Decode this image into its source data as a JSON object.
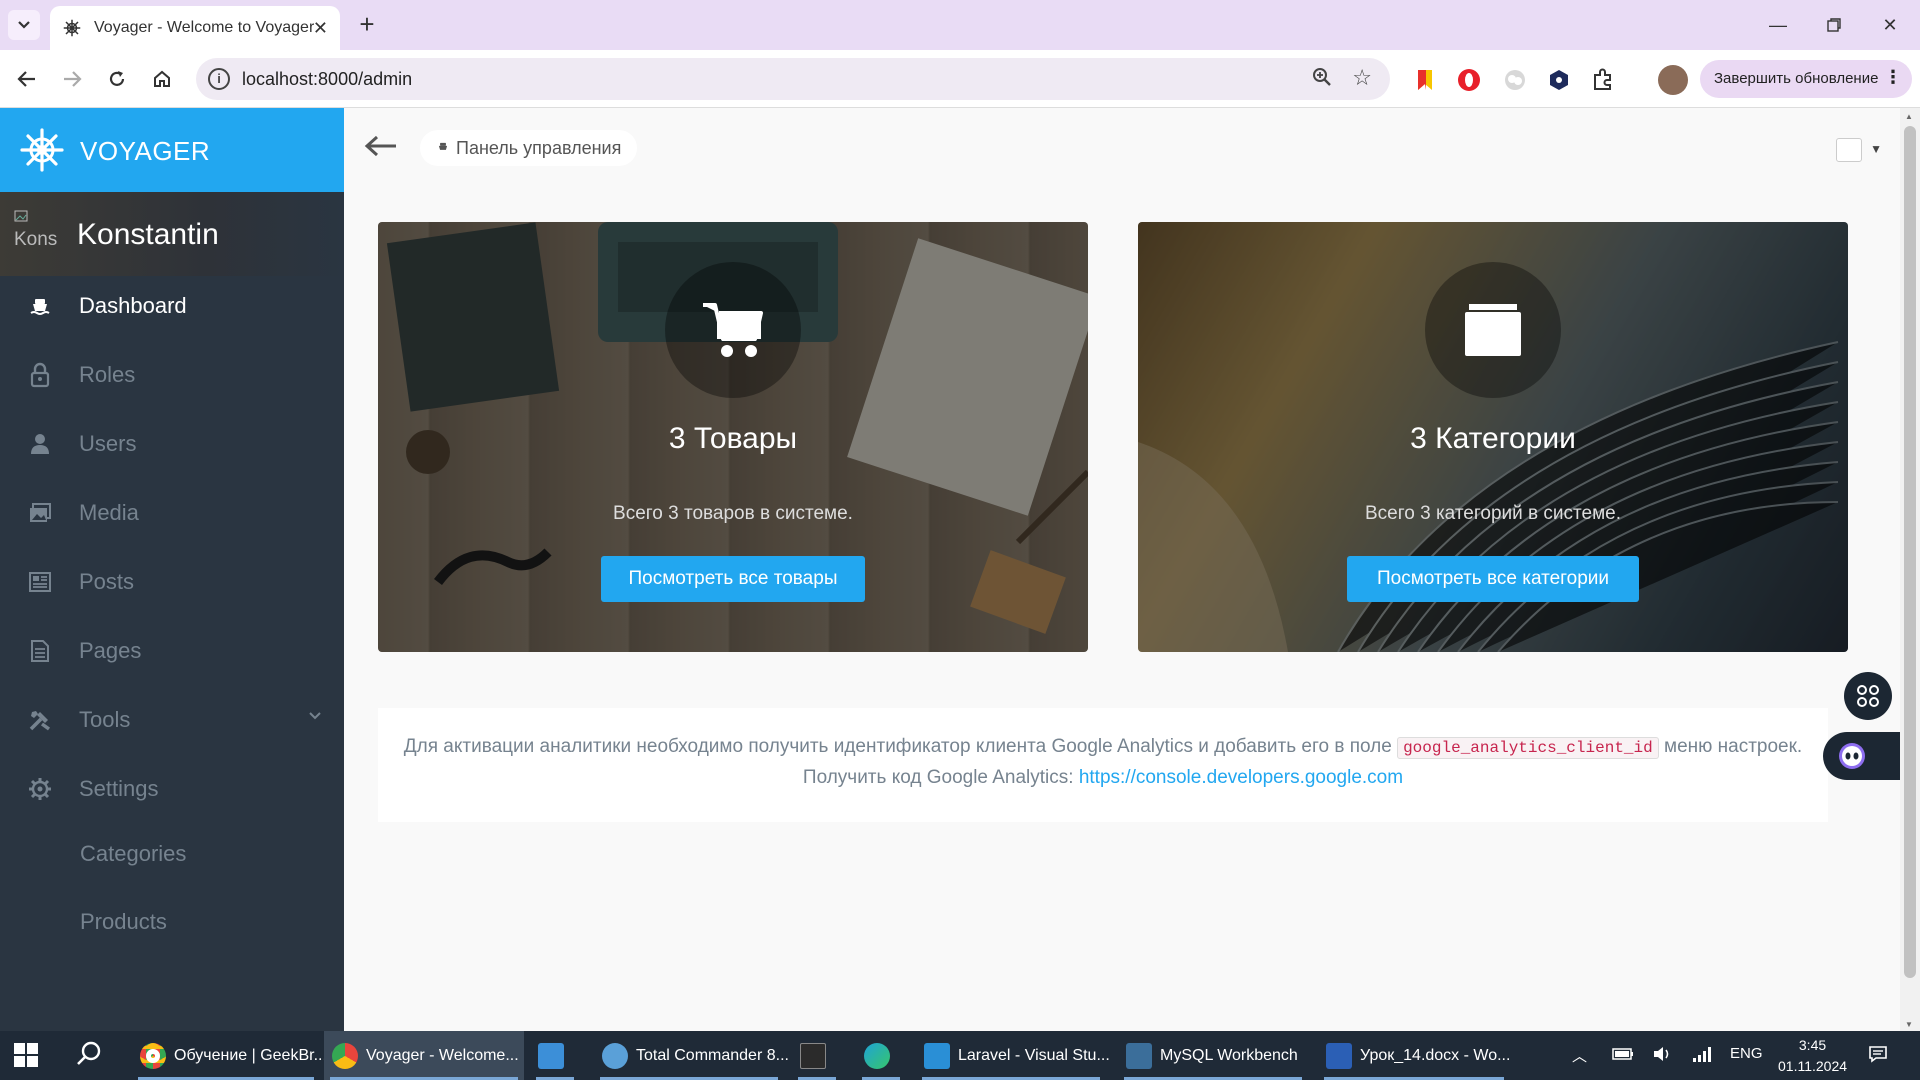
{
  "browser": {
    "tab_title": "Voyager - Welcome to Voyager",
    "url": "localhost:8000/admin",
    "update_button": "Завершить обновление"
  },
  "sidebar": {
    "brand": "VOYAGER",
    "user_name": "Konstantin",
    "avatar_alt": "Kons",
    "items": [
      {
        "label": "Dashboard",
        "icon": "boat-icon",
        "active": true
      },
      {
        "label": "Roles",
        "icon": "lock-icon"
      },
      {
        "label": "Users",
        "icon": "person-icon"
      },
      {
        "label": "Media",
        "icon": "images-icon"
      },
      {
        "label": "Posts",
        "icon": "news-icon"
      },
      {
        "label": "Pages",
        "icon": "file-text-icon"
      },
      {
        "label": "Tools",
        "icon": "tools-icon"
      },
      {
        "label": "Settings",
        "icon": "gear-icon"
      }
    ],
    "subitems": [
      {
        "label": "Categories"
      },
      {
        "label": "Products"
      }
    ]
  },
  "main": {
    "breadcrumb": "Панель управления",
    "cards": [
      {
        "title": "3 Товары",
        "description": "Всего 3 товаров в системе.",
        "button": "Посмотреть все товары",
        "icon": "cart-icon"
      },
      {
        "title": "3 Категории",
        "description": "Всего 3 категорий в системе.",
        "button": "Посмотреть все категории",
        "icon": "folder-icon"
      }
    ],
    "analytics": {
      "text_before": "Для активации аналитики необходимо получить идентификатор клиента Google Analytics и добавить его в поле",
      "code": "google_analytics_client_id",
      "text_after": "меню настроек. Получить код Google Analytics:",
      "link": "https://console.developers.google.com"
    }
  },
  "taskbar": {
    "apps": [
      {
        "label": "Обучение | GeekBr...",
        "color": "#e8453c"
      },
      {
        "label": "Voyager - Welcome...",
        "color": "#e8453c",
        "active": true
      },
      {
        "label": "",
        "color": "#3c8fd8"
      },
      {
        "label": "Total Commander 8...",
        "color": "#5aa0d8"
      },
      {
        "label": "",
        "color": "#2b2b2b"
      },
      {
        "label": "",
        "color": "#1fa3d6"
      },
      {
        "label": "Laravel - Visual Stu...",
        "color": "#2a8fd6"
      },
      {
        "label": "MySQL Workbench",
        "color": "#3b6e9a"
      },
      {
        "label": "Урок_14.docx - Wo...",
        "color": "#2b5fb5"
      }
    ],
    "language": "ENG",
    "time": "3:45",
    "date": "01.11.2024"
  }
}
